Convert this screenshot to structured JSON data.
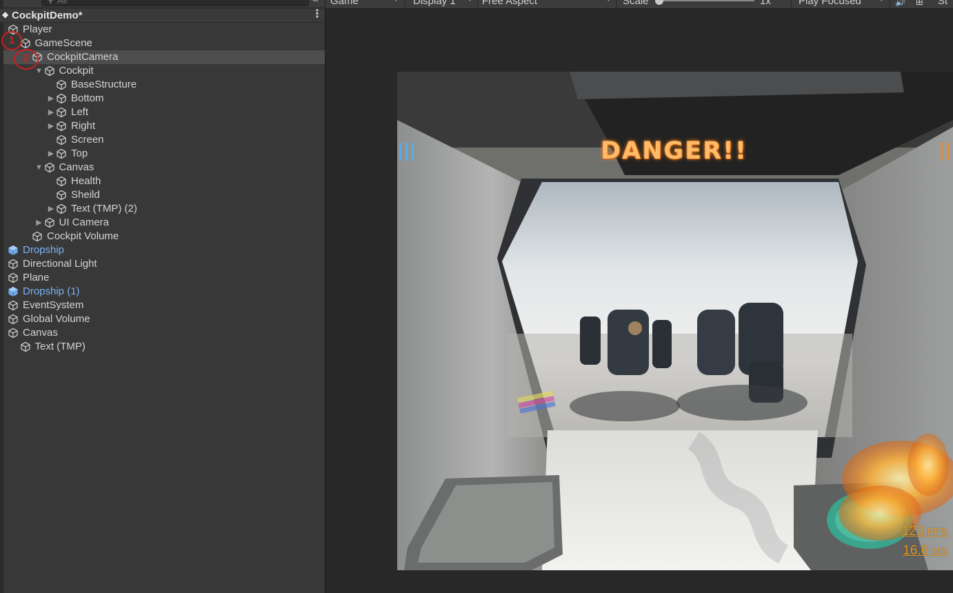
{
  "hierarchy": {
    "search_placeholder": "All",
    "scene_title": "CockpitDemo*",
    "items": [
      {
        "label": "Player",
        "depth": 0,
        "arrow": "",
        "prefab": false,
        "selected": false
      },
      {
        "label": "GameScene",
        "depth": 1,
        "arrow": "",
        "prefab": false,
        "selected": false
      },
      {
        "label": "CockpitCamera",
        "depth": 2,
        "arrow": "",
        "prefab": false,
        "selected": true
      },
      {
        "label": "Cockpit",
        "depth": 3,
        "arrow": "down",
        "prefab": false,
        "selected": false
      },
      {
        "label": "BaseStructure",
        "depth": 4,
        "arrow": "",
        "prefab": false,
        "selected": false
      },
      {
        "label": "Bottom",
        "depth": 4,
        "arrow": "right",
        "prefab": false,
        "selected": false
      },
      {
        "label": "Left",
        "depth": 4,
        "arrow": "right",
        "prefab": false,
        "selected": false
      },
      {
        "label": "Right",
        "depth": 4,
        "arrow": "right",
        "prefab": false,
        "selected": false
      },
      {
        "label": "Screen",
        "depth": 4,
        "arrow": "",
        "prefab": false,
        "selected": false
      },
      {
        "label": "Top",
        "depth": 4,
        "arrow": "right",
        "prefab": false,
        "selected": false
      },
      {
        "label": "Canvas",
        "depth": 3,
        "arrow": "down",
        "prefab": false,
        "selected": false
      },
      {
        "label": "Health",
        "depth": 4,
        "arrow": "",
        "prefab": false,
        "selected": false
      },
      {
        "label": "Sheild",
        "depth": 4,
        "arrow": "",
        "prefab": false,
        "selected": false
      },
      {
        "label": "Text (TMP) (2)",
        "depth": 4,
        "arrow": "right",
        "prefab": false,
        "selected": false
      },
      {
        "label": "UI Camera",
        "depth": 3,
        "arrow": "right",
        "prefab": false,
        "selected": false
      },
      {
        "label": "Cockpit Volume",
        "depth": 2,
        "arrow": "",
        "prefab": false,
        "selected": false
      },
      {
        "label": "Dropship",
        "depth": 0,
        "arrow": "",
        "prefab": true,
        "selected": false
      },
      {
        "label": "Directional Light",
        "depth": 0,
        "arrow": "",
        "prefab": false,
        "selected": false
      },
      {
        "label": "Plane",
        "depth": 0,
        "arrow": "",
        "prefab": false,
        "selected": false
      },
      {
        "label": "Dropship (1)",
        "depth": 0,
        "arrow": "",
        "prefab": true,
        "selected": false
      },
      {
        "label": "EventSystem",
        "depth": 0,
        "arrow": "",
        "prefab": false,
        "selected": false
      },
      {
        "label": "Global Volume",
        "depth": 0,
        "arrow": "",
        "prefab": false,
        "selected": false
      },
      {
        "label": "Canvas",
        "depth": 0,
        "arrow": "",
        "prefab": false,
        "selected": false
      },
      {
        "label": "Text (TMP)",
        "depth": 1,
        "arrow": "",
        "prefab": false,
        "selected": false
      }
    ]
  },
  "annotations": [
    "1",
    "2"
  ],
  "game_toolbar": {
    "view": "Game",
    "display": "Display 1",
    "aspect": "Free Aspect",
    "scale_label": "Scale",
    "scale_value": "1x",
    "play_mode": "Play Focused",
    "stats_partial": "St"
  },
  "game_view": {
    "warning": "DANGER!!",
    "fps": "123",
    "fps_unit": "FPS",
    "ms": "16.6",
    "ms_unit": "MS"
  },
  "colors": {
    "panel_bg": "#383838",
    "selection": "#4d4d4d",
    "prefab_text": "#7cb3f4",
    "warning_text": "#ffba6a",
    "stats_text": "#e39a22",
    "annotation": "#d21f1f"
  },
  "icons": {
    "gameobject": "cube-outline-icon",
    "prefab": "prefab-cube-icon",
    "search": "search-icon",
    "scene": "unity-scene-icon",
    "menu": "kebab-menu-icon"
  }
}
